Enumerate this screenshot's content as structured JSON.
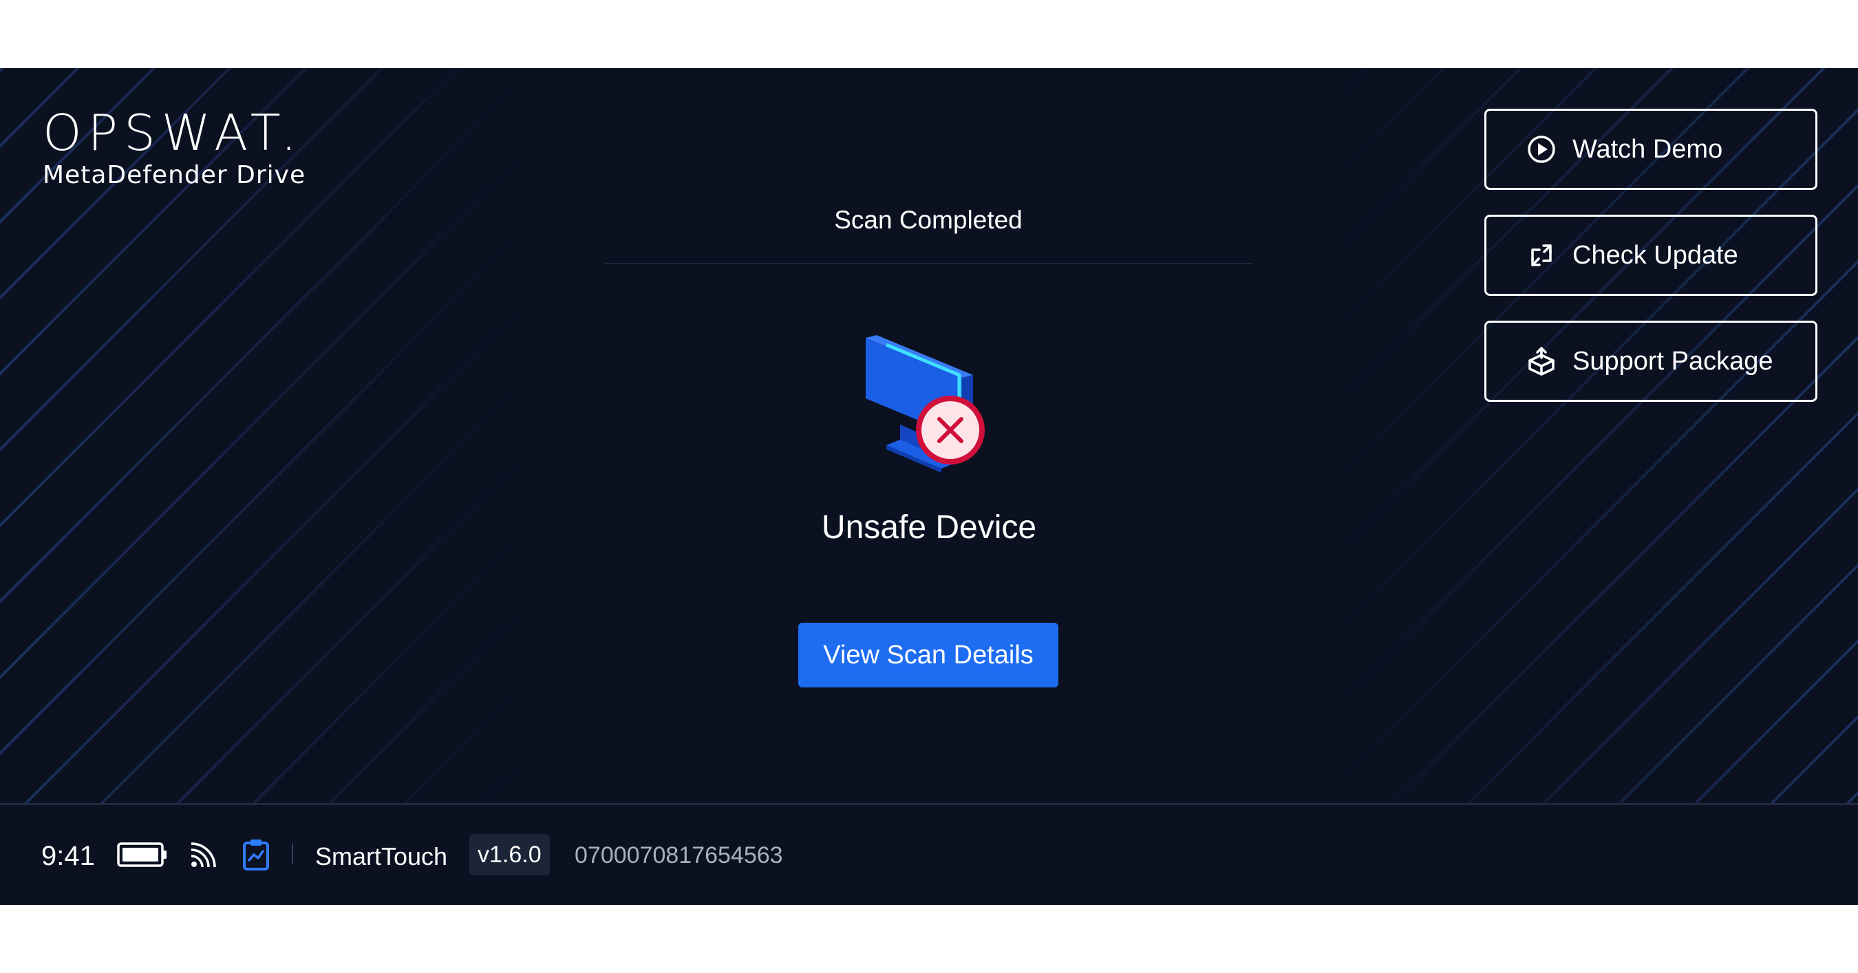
{
  "brand": {
    "logo_text": "OPSWAT.",
    "product_name": "MetaDefender Drive"
  },
  "scan": {
    "status_title": "Scan Completed",
    "result": "Unsafe Device",
    "view_details_label": "View Scan Details",
    "result_icon": "unsafe-device-icon"
  },
  "actions": [
    {
      "label": "Watch Demo",
      "icon": "play-circle-icon"
    },
    {
      "label": "Check Update",
      "icon": "refresh-icon"
    },
    {
      "label": "Support Package",
      "icon": "package-upload-icon"
    }
  ],
  "footer": {
    "time": "9:41",
    "device_name": "SmartTouch",
    "version": "v1.6.0",
    "serial": "0700070817654563",
    "icons": [
      "battery-icon",
      "wifi-icon",
      "clipboard-chart-icon"
    ]
  },
  "colors": {
    "background": "#0b1121",
    "accent": "#1d6cf2",
    "danger": "#d0103a"
  }
}
